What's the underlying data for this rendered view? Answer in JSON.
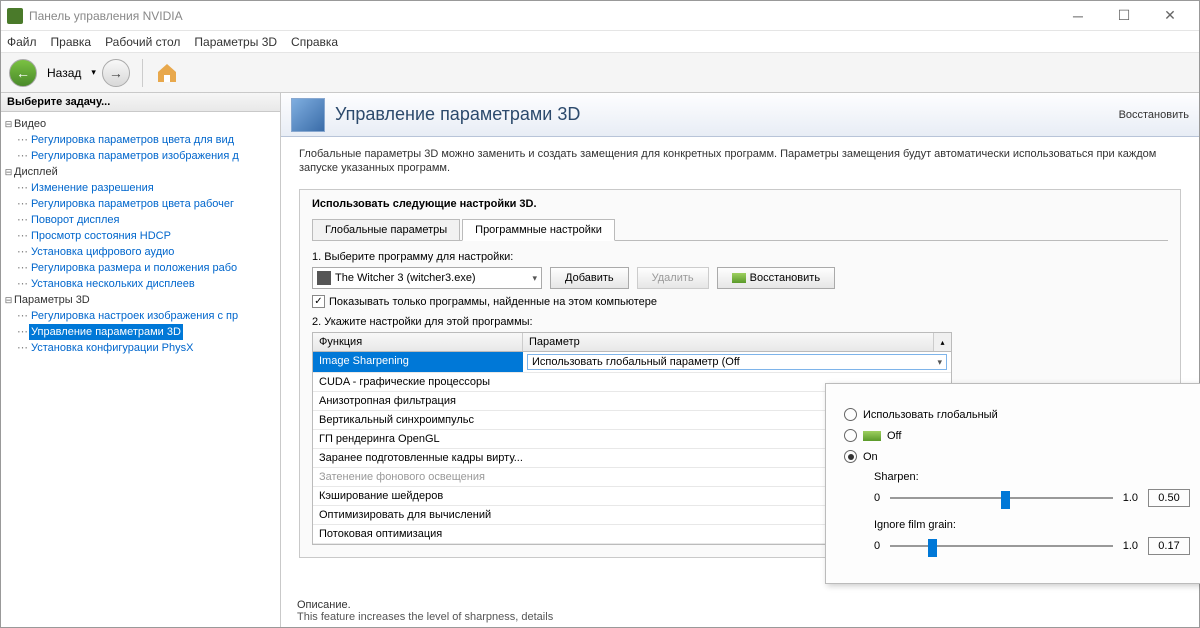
{
  "window": {
    "title": "Панель управления NVIDIA"
  },
  "menu": {
    "file": "Файл",
    "edit": "Правка",
    "desktop": "Рабочий стол",
    "params3d": "Параметры 3D",
    "help": "Справка"
  },
  "toolbar": {
    "back": "Назад"
  },
  "sidebar": {
    "header": "Выберите задачу...",
    "video": "Видео",
    "video_items": [
      "Регулировка параметров цвета для вид",
      "Регулировка параметров изображения д"
    ],
    "display": "Дисплей",
    "display_items": [
      "Изменение разрешения",
      "Регулировка параметров цвета рабочег",
      "Поворот дисплея",
      "Просмотр состояния HDCP",
      "Установка цифрового аудио",
      "Регулировка размера и положения рабо",
      "Установка нескольких дисплеев"
    ],
    "params3d": "Параметры 3D",
    "params3d_items": [
      "Регулировка настроек изображения с пр",
      "Управление параметрами 3D",
      "Установка конфигурации PhysX"
    ]
  },
  "content": {
    "title": "Управление параметрами 3D",
    "restore": "Восстановить",
    "desc": "Глобальные параметры 3D можно заменить и создать замещения для конкретных программ. Параметры замещения будут автоматически использоваться при каждом запуске указанных программ.",
    "panel_hdr": "Использовать следующие настройки 3D.",
    "tab_global": "Глобальные параметры",
    "tab_program": "Программные настройки",
    "step1": "1. Выберите программу для настройки:",
    "program": "The Witcher 3 (witcher3.exe)",
    "add": "Добавить",
    "remove": "Удалить",
    "restore_btn": "Восстановить",
    "show_only": "Показывать только программы, найденные на этом компьютере",
    "step2": "2. Укажите настройки для этой программы:",
    "col_func": "Функция",
    "col_param": "Параметр",
    "rows": [
      {
        "f": "Image Sharpening",
        "sel": true
      },
      {
        "f": "CUDA - графические процессоры"
      },
      {
        "f": "Анизотропная фильтрация"
      },
      {
        "f": "Вертикальный синхроимпульс"
      },
      {
        "f": "ГП рендеринга OpenGL"
      },
      {
        "f": "Заранее подготовленные кадры вирту..."
      },
      {
        "f": "Затенение фонового освещения",
        "dim": true
      },
      {
        "f": "Кэширование шейдеров"
      },
      {
        "f": "Оптимизировать для вычислений"
      },
      {
        "f": "Потоковая оптимизация"
      }
    ],
    "sel_param": "Использовать глобальный параметр (Off",
    "foot_h": "Описание.",
    "foot_t": "This feature increases the level of sharpness, details"
  },
  "popup": {
    "opt_global": "Использовать глобальный",
    "opt_off": "Off",
    "opt_on": "On",
    "sharpen_label": "Sharpen:",
    "sharpen_min": "0",
    "sharpen_max": "1.0",
    "sharpen_val": "0.50",
    "grain_label": "Ignore film grain:",
    "grain_min": "0",
    "grain_max": "1.0",
    "grain_val": "0.17"
  }
}
